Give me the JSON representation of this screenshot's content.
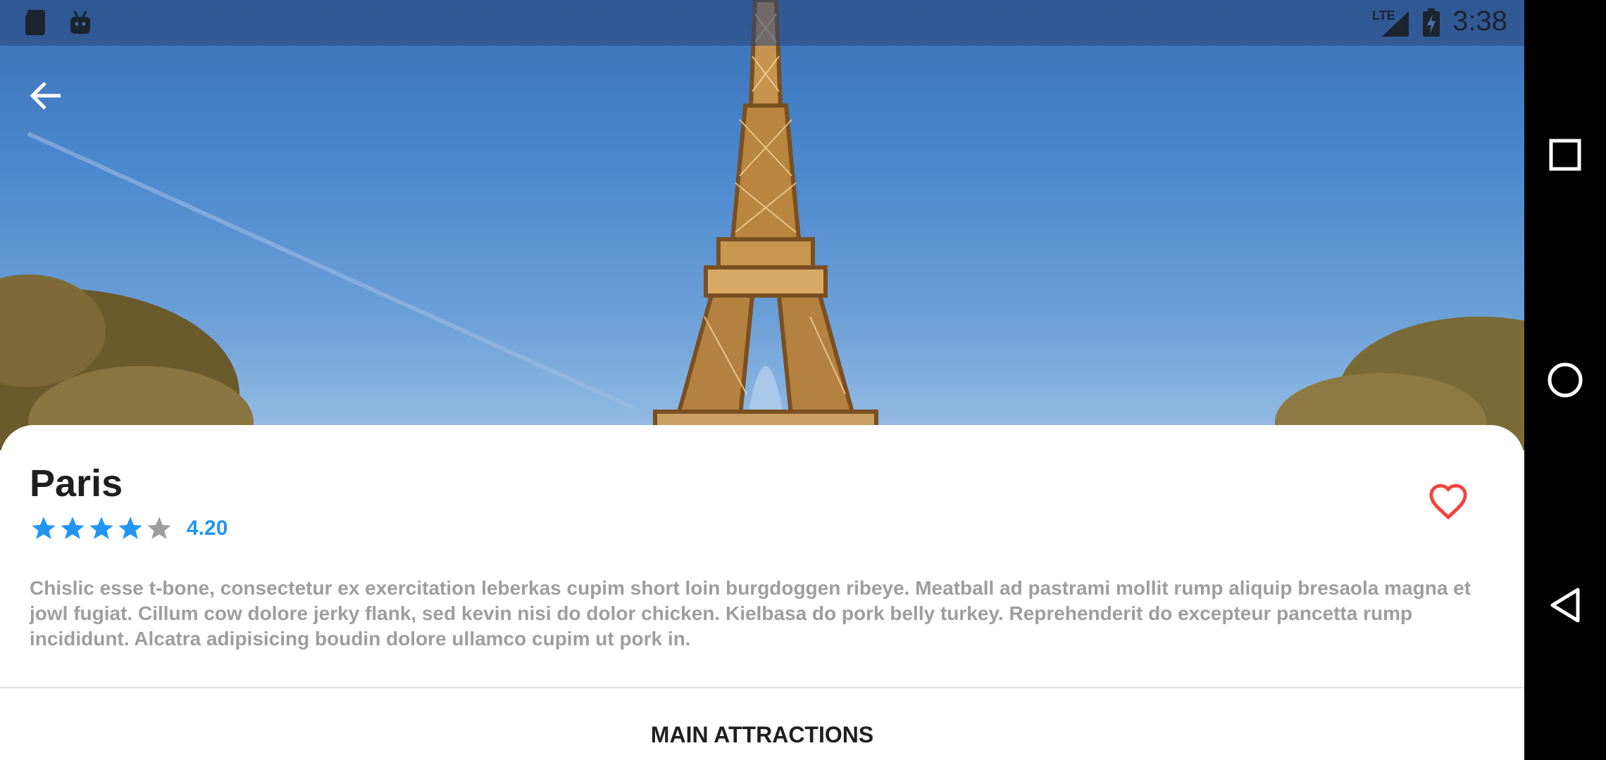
{
  "status_bar": {
    "time": "3:38",
    "network": "LTE",
    "icons": [
      "sd-card-icon",
      "android-icon",
      "lte-signal-icon",
      "battery-charging-icon"
    ]
  },
  "hero": {
    "image": "eiffel-tower-photo"
  },
  "toolbar": {
    "back_icon": "arrow-left-icon"
  },
  "place": {
    "title": "Paris",
    "rating": 4.2,
    "rating_label": "4.20",
    "stars_filled": 4,
    "stars_total": 5,
    "favorite_icon": "heart-outline-icon",
    "description": "Chislic esse t-bone, consectetur ex exercitation leberkas cupim short loin burgdoggen ribeye. Meatball ad pastrami mollit rump aliquip bresaola magna et jowl fugiat. Cillum cow dolore jerky flank, sed kevin nisi do dolor chicken. Kielbasa do pork belly turkey. Reprehenderit do excepteur pancetta rump incididunt. Alcatra adipisicing boudin dolore ullamco cupim ut pork in."
  },
  "sections": {
    "main_attractions": "MAIN ATTRACTIONS"
  },
  "nav_bar": {
    "buttons": [
      "recents-square-icon",
      "home-circle-icon",
      "back-triangle-icon"
    ]
  },
  "colors": {
    "accent": "#2196f3",
    "star_filled": "#2196f3",
    "star_empty": "#9e9e9e",
    "favorite": "#f44336",
    "text_primary": "#1f1f1f",
    "text_secondary": "#9e9e9e"
  }
}
